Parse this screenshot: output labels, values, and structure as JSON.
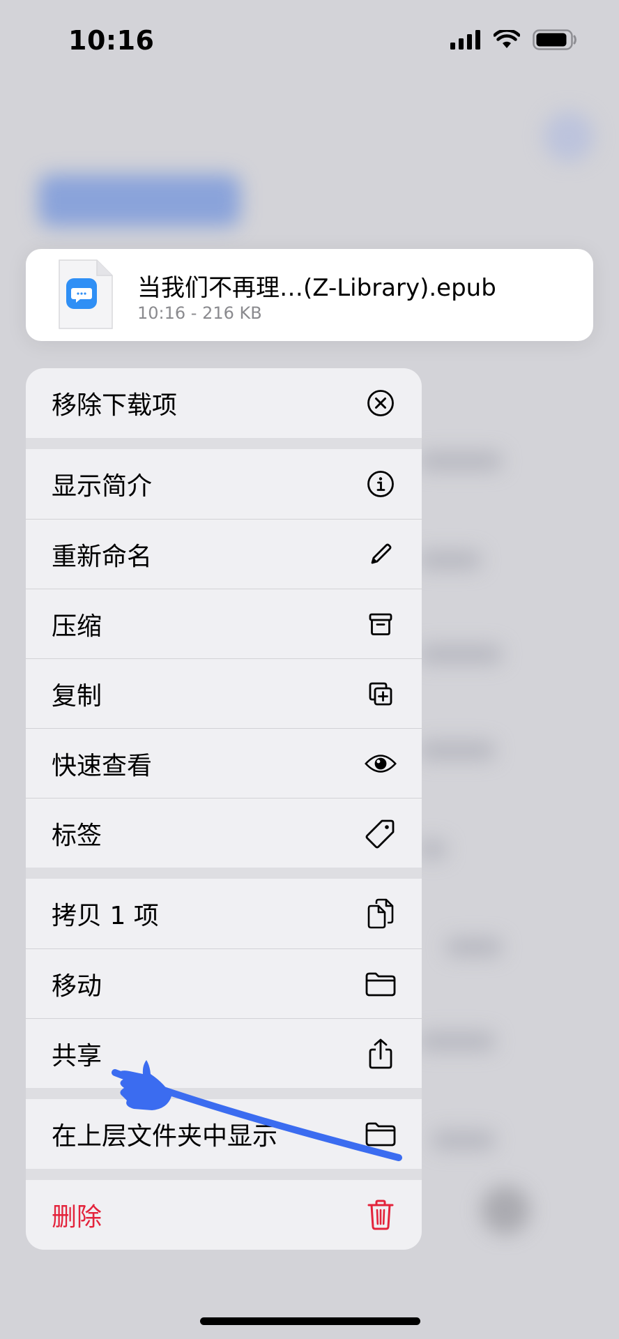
{
  "status_bar": {
    "time": "10:16"
  },
  "file": {
    "name": "当我们不再理…(Z-Library).epub",
    "meta": "10:16 - 216 KB",
    "thumb_color": "#2f8ff5"
  },
  "menu": {
    "groups": [
      [
        {
          "label": "移除下载项",
          "icon": "x-circle-icon"
        }
      ],
      [
        {
          "label": "显示简介",
          "icon": "info-circle-icon"
        },
        {
          "label": "重新命名",
          "icon": "pencil-icon"
        },
        {
          "label": "压缩",
          "icon": "archive-box-icon"
        },
        {
          "label": "复制",
          "icon": "duplicate-plus-icon"
        },
        {
          "label": "快速查看",
          "icon": "eye-icon"
        },
        {
          "label": "标签",
          "icon": "tag-icon"
        }
      ],
      [
        {
          "label": "拷贝 1 项",
          "icon": "copy-docs-icon"
        },
        {
          "label": "移动",
          "icon": "folder-icon"
        },
        {
          "label": "共享",
          "icon": "share-icon"
        }
      ],
      [
        {
          "label": "在上层文件夹中显示",
          "icon": "folder-icon"
        }
      ],
      [
        {
          "label": "删除",
          "icon": "trash-icon",
          "destructive": true
        }
      ]
    ]
  },
  "colors": {
    "destructive": "#e3233b",
    "annotation": "#3b6cf0"
  }
}
